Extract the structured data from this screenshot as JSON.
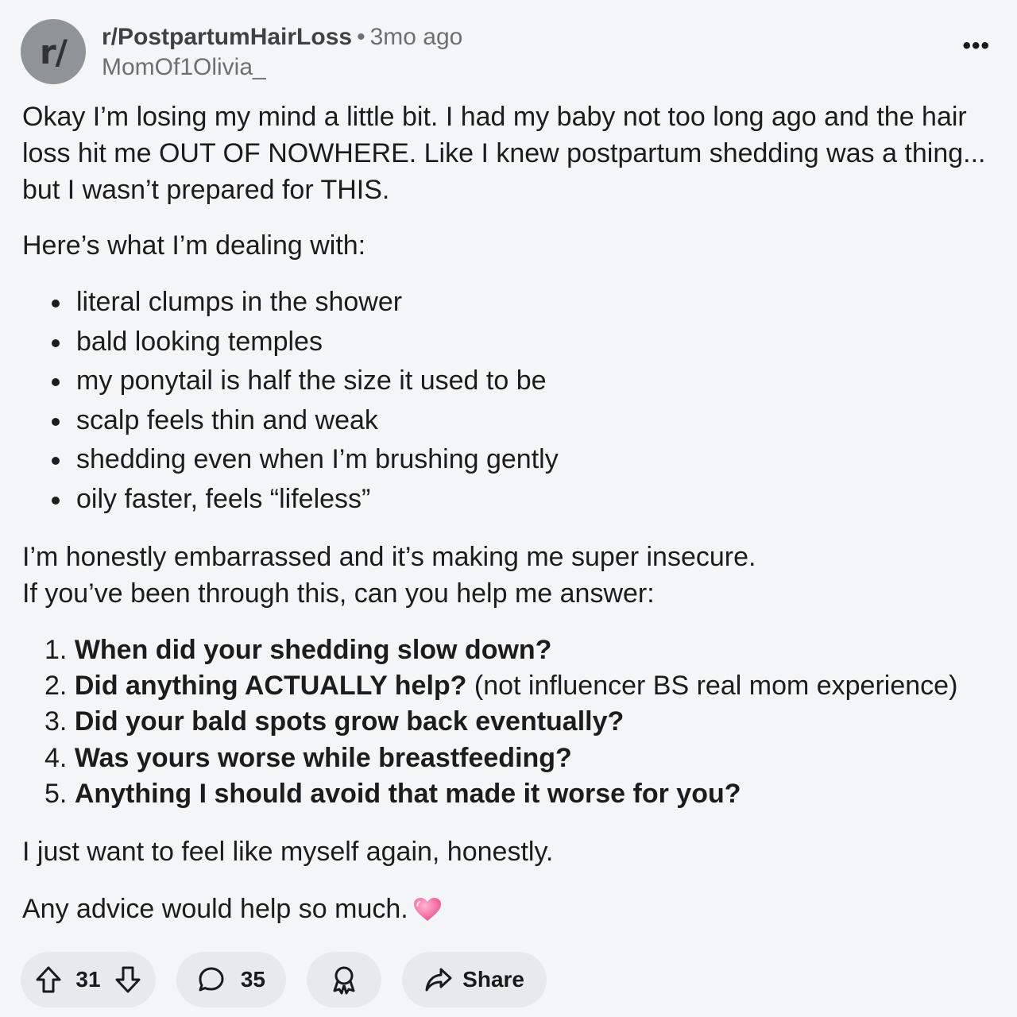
{
  "header": {
    "avatar_text": "r/",
    "subreddit": "r/PostpartumHairLoss",
    "separator": "•",
    "time": "3mo ago",
    "author": "MomOf1Olivia_",
    "more_label": "•••"
  },
  "post": {
    "intro": "Okay I’m losing my mind a little bit. I had my baby not too long ago and the hair loss hit me OUT OF NOWHERE. Like I knew postpartum shedding was a thing... but I wasn’t prepared for THIS.",
    "dealing": "Here’s what I’m dealing with:",
    "bullets": [
      "literal clumps in the shower",
      "bald looking temples",
      "my ponytail is half the size it used to be",
      "scalp feels thin and weak",
      "shedding even when I’m brushing gently",
      "oily faster, feels “lifeless”"
    ],
    "insecure_line1": "I’m honestly embarrassed and it’s making me super insecure.",
    "insecure_line2": "If you’ve been through this, can you help me answer:",
    "questions": [
      {
        "num": "1.",
        "bold": "When did your shedding slow down?",
        "rest": ""
      },
      {
        "num": "2.",
        "bold": "Did anything ACTUALLY help?",
        "rest": " (not influencer BS real mom experience)"
      },
      {
        "num": "3.",
        "bold": "Did your bald spots grow back eventually?",
        "rest": ""
      },
      {
        "num": "4.",
        "bold": "Was yours worse while breastfeeding?",
        "rest": ""
      },
      {
        "num": "5.",
        "bold": "Anything I should avoid that made it worse for you?",
        "rest": ""
      }
    ],
    "myself": "I just want to feel like myself again, honestly.",
    "advice": "Any advice would help so much.",
    "emoji": "pink-heart"
  },
  "actions": {
    "vote_count": "31",
    "comment_count": "35",
    "share_label": "Share"
  },
  "colors": {
    "background": "#f4f5f6",
    "pill": "#e7eaeb",
    "avatar": "#8e9497",
    "heart": "#f06292"
  },
  "icons": {
    "upvote": "upvote-arrow-icon",
    "downvote": "downvote-arrow-icon",
    "comment": "comment-bubble-icon",
    "award": "award-icon",
    "share": "share-arrow-icon",
    "more": "more-options-icon"
  }
}
